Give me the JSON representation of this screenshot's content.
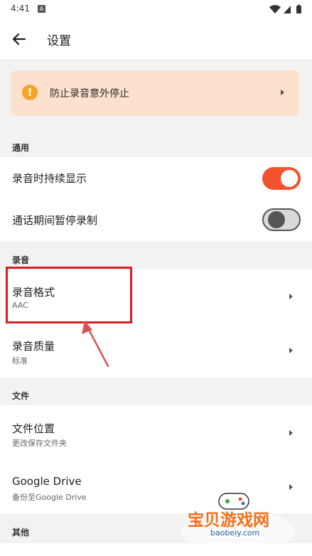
{
  "status_bar": {
    "time": "4:41",
    "badge": "A"
  },
  "appbar": {
    "title": "设置"
  },
  "banner": {
    "text": "防止录音意外停止"
  },
  "sections": {
    "general": "通用",
    "recording": "录音",
    "files": "文件",
    "other": "其他"
  },
  "general_items": [
    {
      "title": "录音时持续显示",
      "toggle": "on"
    },
    {
      "title": "通话期间暂停录制",
      "toggle": "off"
    }
  ],
  "recording_items": [
    {
      "title": "录音格式",
      "subtitle": "AAC"
    },
    {
      "title": "录音质量",
      "subtitle": "标准"
    }
  ],
  "file_items": [
    {
      "title": "文件位置",
      "subtitle": "更改保存文件夹"
    },
    {
      "title": "Google Drive",
      "subtitle": "备份至Google Drive"
    }
  ],
  "watermark": {
    "title": "宝贝游戏网",
    "domain": "baobeiy.com"
  },
  "colors": {
    "accent": "#f2522e",
    "banner_bg": "#fde1cf",
    "warning": "#f4a42a",
    "annotation": "#d61f24"
  }
}
